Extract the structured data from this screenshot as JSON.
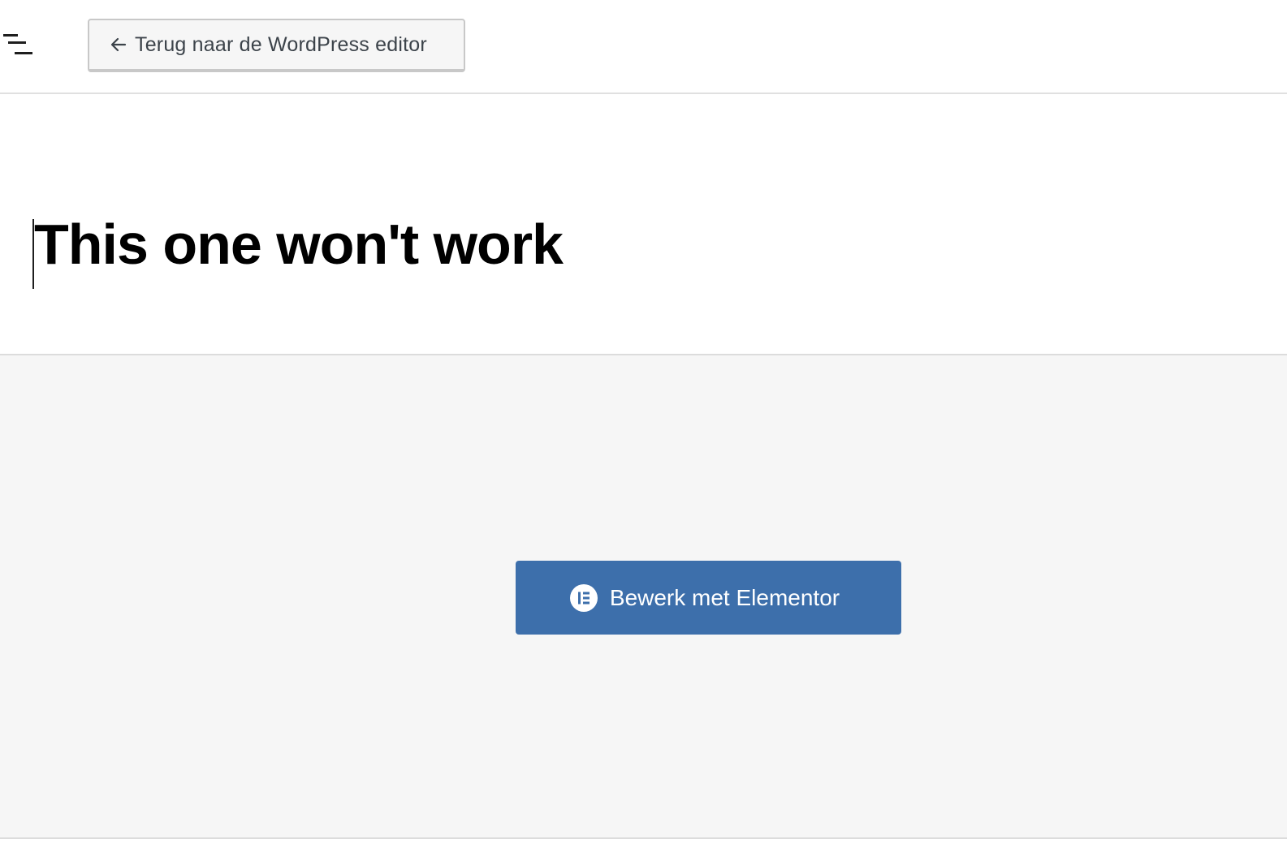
{
  "toolbar": {
    "back_label": "Terug naar de WordPress editor"
  },
  "post": {
    "title": "This one won't work"
  },
  "elementor": {
    "button_label": "Bewerk met Elementor",
    "brand_color": "#3d6fab"
  },
  "icons": {
    "menu": "document-overview-icon",
    "back": "arrow-left-icon",
    "elementor": "elementor-logo-icon"
  }
}
